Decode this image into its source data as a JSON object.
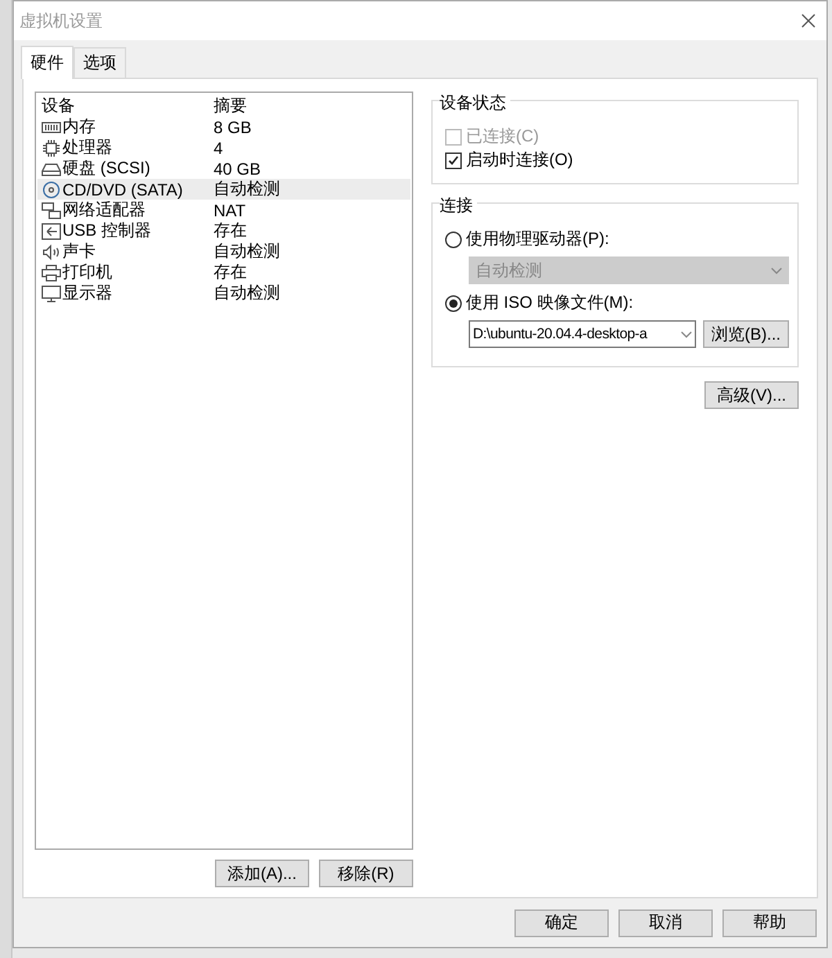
{
  "window": {
    "title": "虚拟机设置"
  },
  "tabs": [
    {
      "label": "硬件",
      "selected": true
    },
    {
      "label": "选项",
      "selected": false
    }
  ],
  "devices": {
    "columns": [
      "设备",
      "摘要"
    ],
    "rows": [
      {
        "kind": "memory",
        "name": "内存",
        "summary": "8 GB",
        "selected": false
      },
      {
        "kind": "cpu",
        "name": "处理器",
        "summary": "4",
        "selected": false
      },
      {
        "kind": "disk",
        "name": "硬盘 (SCSI)",
        "summary": "40 GB",
        "selected": false
      },
      {
        "kind": "cd",
        "name": "CD/DVD (SATA)",
        "summary": "自动检测",
        "selected": true
      },
      {
        "kind": "network",
        "name": "网络适配器",
        "summary": "NAT",
        "selected": false
      },
      {
        "kind": "usb",
        "name": "USB 控制器",
        "summary": "存在",
        "selected": false
      },
      {
        "kind": "sound",
        "name": "声卡",
        "summary": "自动检测",
        "selected": false
      },
      {
        "kind": "printer",
        "name": "打印机",
        "summary": "存在",
        "selected": false
      },
      {
        "kind": "display",
        "name": "显示器",
        "summary": "自动检测",
        "selected": false
      }
    ]
  },
  "device_buttons": [
    "添加(A)...",
    "移除(R)"
  ],
  "device_status": {
    "title": "设备状态",
    "items": [
      {
        "label": "已连接(C)",
        "checked": false,
        "disabled": true
      },
      {
        "label": "启动时连接(O)",
        "checked": true,
        "disabled": false
      }
    ]
  },
  "connection": {
    "title": "连接",
    "options": [
      {
        "label": "使用物理驱动器(P):",
        "selected": false,
        "field": {
          "value": "自动检测",
          "disabled": true
        }
      },
      {
        "label": "使用 ISO 映像文件(M):",
        "selected": true,
        "field": {
          "value": "D:\\ubuntu-20.04.4-desktop-a",
          "disabled": false
        },
        "button": "浏览(B)..."
      }
    ]
  },
  "advanced_button": "高级(V)...",
  "footer_buttons": [
    "确定",
    "取消",
    "帮助"
  ]
}
